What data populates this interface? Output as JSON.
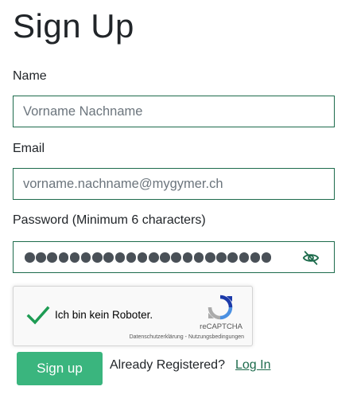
{
  "page": {
    "title": "Sign Up"
  },
  "form": {
    "name": {
      "label": "Name",
      "placeholder": "Vorname Nachname",
      "value": ""
    },
    "email": {
      "label": "Email",
      "placeholder": "vorname.nachname@mygymer.ch",
      "value": ""
    },
    "password": {
      "label": "Password (Minimum 6 characters)",
      "masked_length": 22,
      "toggle_icon": "eye-off-icon"
    }
  },
  "recaptcha": {
    "checked": true,
    "label": "Ich bin kein Roboter.",
    "brand": "reCAPTCHA",
    "privacy_link": "Datenschutzerklärung",
    "separator": " - ",
    "terms_link": "Nutzungsbedingungen"
  },
  "actions": {
    "signup_label": "Sign up",
    "already_registered": "Already Registered?",
    "login_label": "Log In"
  },
  "colors": {
    "accent_border": "#1d6b4c",
    "button_bg": "#3ab57e",
    "check_green": "#1e9c54",
    "text": "#212529"
  }
}
